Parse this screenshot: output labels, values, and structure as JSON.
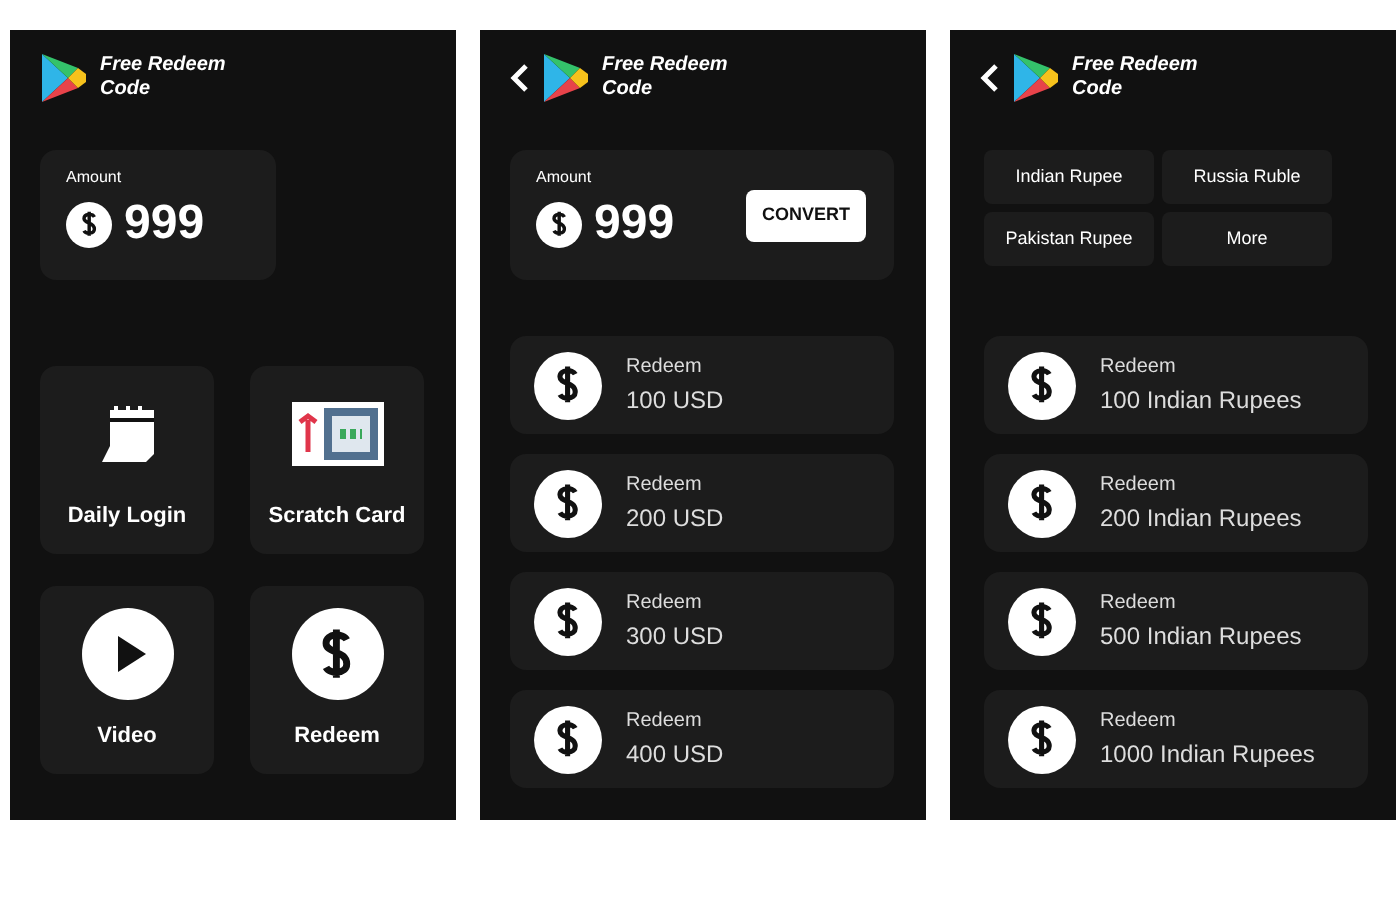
{
  "screens": [
    {
      "kind": "home",
      "header": {
        "back": false,
        "title": "Free Redeem Code"
      },
      "amount": {
        "label": "Amount",
        "value": "999"
      },
      "tiles": [
        {
          "kind": "calendar",
          "label": "Daily Login"
        },
        {
          "kind": "scratch",
          "label": "Scratch Card"
        },
        {
          "kind": "video",
          "label": "Video"
        },
        {
          "kind": "redeem",
          "label": "Redeem"
        }
      ]
    },
    {
      "kind": "convert",
      "header": {
        "back": true,
        "title": "Free Redeem Code"
      },
      "amount": {
        "label": "Amount",
        "value": "999"
      },
      "convert_button": "CONVERT",
      "items": [
        {
          "label": "Redeem",
          "value": "100 USD"
        },
        {
          "label": "Redeem",
          "value": "200 USD"
        },
        {
          "label": "Redeem",
          "value": "300 USD"
        },
        {
          "label": "Redeem",
          "value": "400 USD"
        }
      ]
    },
    {
      "kind": "currency",
      "header": {
        "back": true,
        "title": "Free Redeem Code"
      },
      "chips": [
        "Indian Rupee",
        "Russia Ruble",
        "Pakistan Rupee",
        "More"
      ],
      "items": [
        {
          "label": "Redeem",
          "value": "100 Indian Rupees"
        },
        {
          "label": "Redeem",
          "value": "200 Indian Rupees"
        },
        {
          "label": "Redeem",
          "value": "500 Indian Rupees"
        },
        {
          "label": "Redeem",
          "value": "1000 Indian Rupees"
        }
      ]
    }
  ]
}
